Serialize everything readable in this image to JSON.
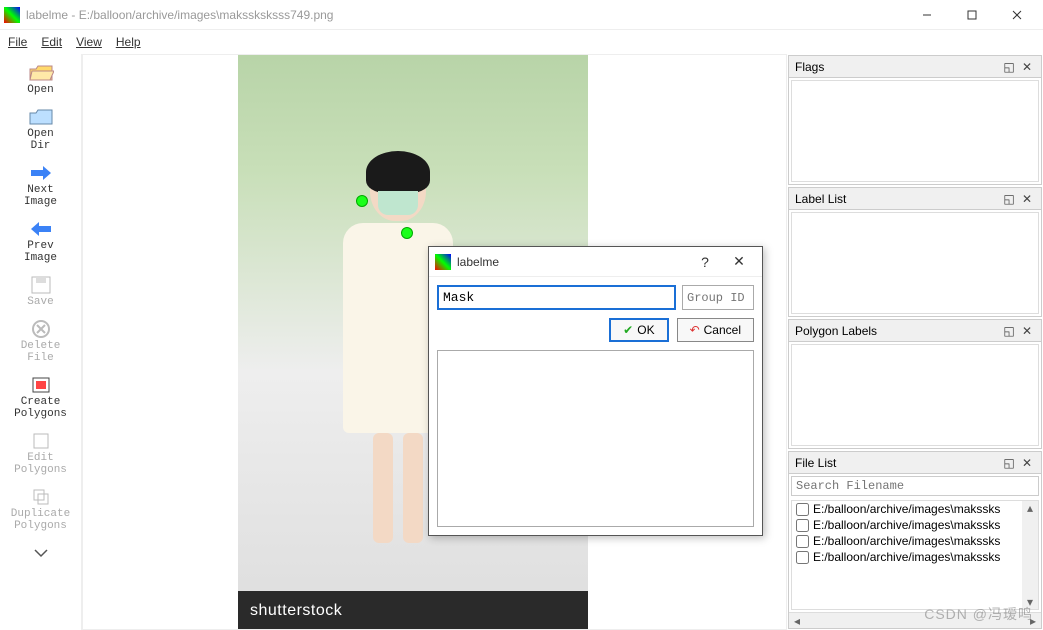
{
  "window": {
    "title": "labelme - E:/balloon/archive/images\\makssksksss749.png"
  },
  "menu": {
    "file": "File",
    "edit": "Edit",
    "view": "View",
    "help": "Help"
  },
  "toolbar": {
    "open": "Open",
    "open_dir": "Open\nDir",
    "next_image": "Next\nImage",
    "prev_image": "Prev\nImage",
    "save": "Save",
    "delete_file": "Delete\nFile",
    "create_polygons": "Create\nPolygons",
    "edit_polygons": "Edit\nPolygons",
    "duplicate_polygons": "Duplicate\nPolygons"
  },
  "canvas": {
    "watermark": "shutterstock"
  },
  "dialog": {
    "title": "labelme",
    "label_value": "Mask",
    "group_placeholder": "Group ID",
    "ok": "OK",
    "cancel": "Cancel"
  },
  "panels": {
    "flags": "Flags",
    "label_list": "Label List",
    "polygon_labels": "Polygon Labels",
    "file_list": "File List",
    "search_placeholder": "Search Filename",
    "files": [
      "E:/balloon/archive/images\\makssks",
      "E:/balloon/archive/images\\makssks",
      "E:/balloon/archive/images\\makssks",
      "E:/balloon/archive/images\\makssks"
    ]
  },
  "watermark_overlay": "CSDN @冯瑷鸣"
}
